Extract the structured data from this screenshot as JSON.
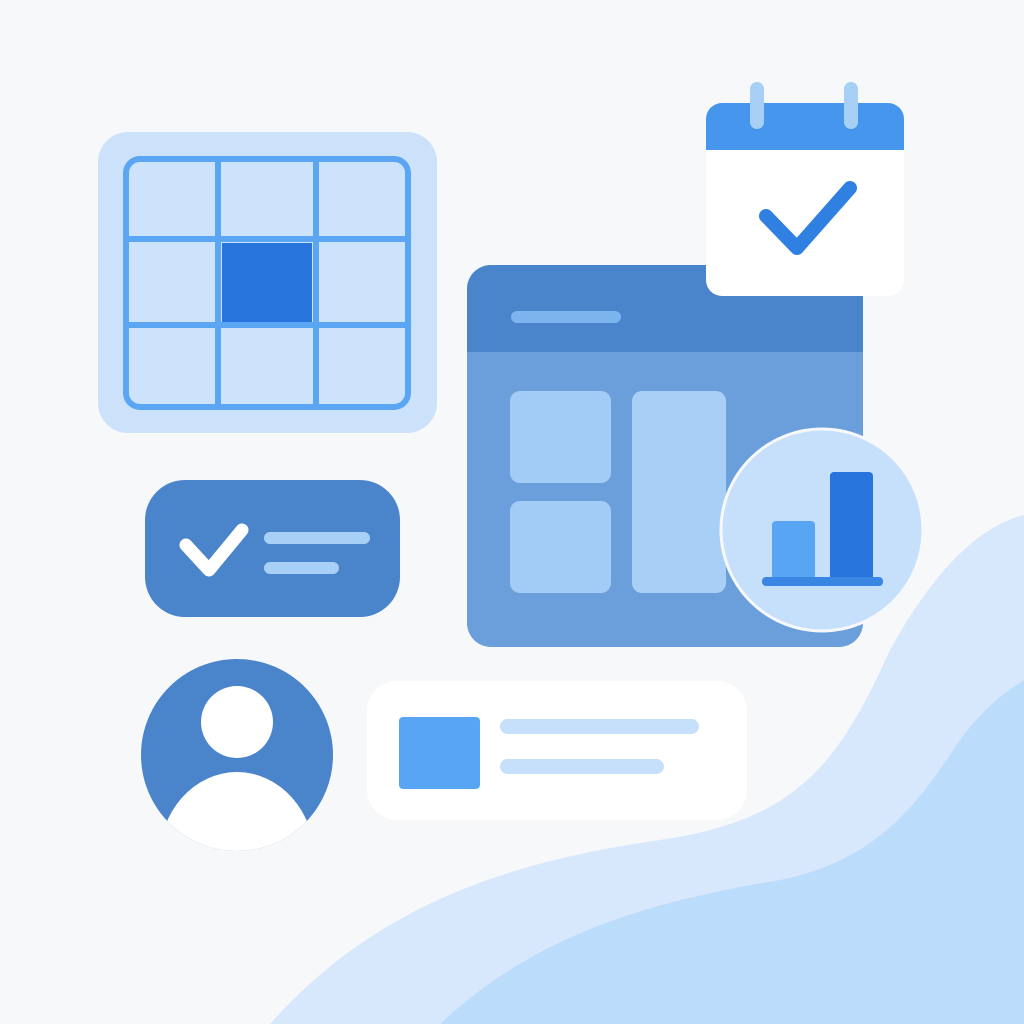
{
  "illustration": {
    "background": "#f7f8fa",
    "colors": {
      "primary": "#2674dc",
      "medium": "#4a84cb",
      "light": "#a2ccf5",
      "pale": "#cde3fb",
      "wave_light": "#d7e8fc",
      "wave_mid": "#bcdcfb",
      "white": "#ffffff"
    },
    "icons": [
      "grid-selection-icon",
      "calendar-check-icon",
      "app-window-icon",
      "bar-chart-icon",
      "checklist-pill-icon",
      "user-avatar-icon",
      "list-card-icon"
    ]
  }
}
